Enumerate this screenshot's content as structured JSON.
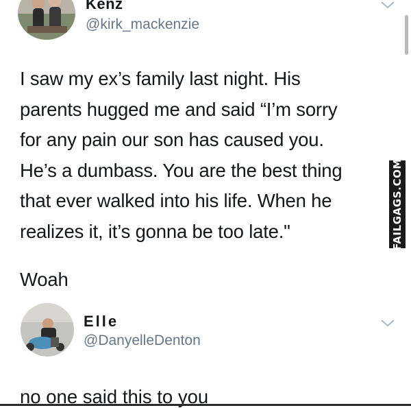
{
  "tweet": {
    "author_name": "Kenz",
    "author_handle": "@kirk_mackenzie",
    "text": "I saw my ex’s family last night. His\nparents hugged me and said “I’m sorry\nfor any pain our son has caused you.\nHe’s a dumbass. You are the best thing\nthat ever walked into his life. When he\nrealizes it, it’s gonna be too late.\"",
    "comment": "Woah"
  },
  "reply": {
    "author_name": "Elle",
    "author_handle": "@DanyelleDenton",
    "text": "no one said this to you"
  },
  "watermark": {
    "text": "FAILGAGS.COM"
  },
  "icons": {
    "menu": "chevron-down-icon",
    "avatar_1": "avatar-photo",
    "avatar_2": "avatar-photo"
  },
  "colors": {
    "text_primary": "#14171a",
    "text_secondary": "#657786",
    "chevron": "#aab8c2",
    "watermark_bg": "#1a1a1a"
  }
}
